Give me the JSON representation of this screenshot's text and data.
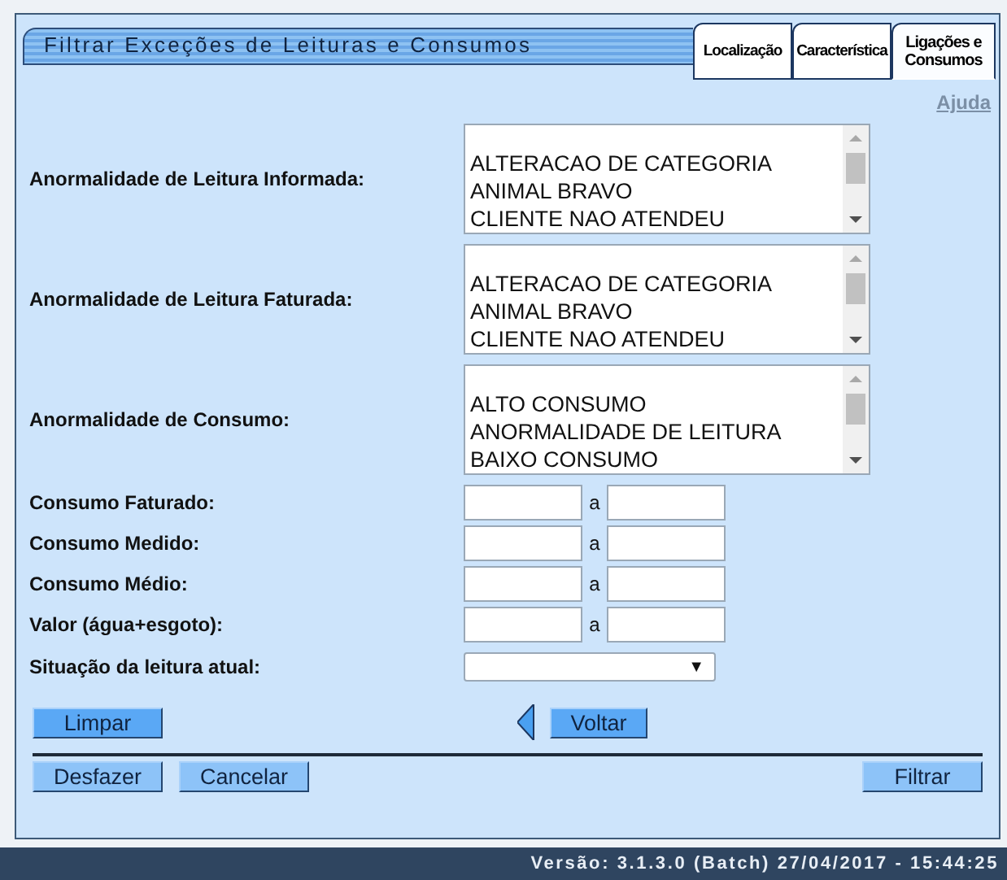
{
  "title": "Filtrar Exceções de Leituras e Consumos",
  "tabs": [
    {
      "label": "Localização",
      "selected": false
    },
    {
      "label": "Característica",
      "selected": false
    },
    {
      "label": "Ligações e Consumos",
      "selected": true
    }
  ],
  "help_link": "Ajuda",
  "list_fields": [
    {
      "label": "Anormalidade de Leitura Informada:",
      "options": [
        "ALTERACAO DE CATEGORIA",
        "ANIMAL BRAVO",
        "CLIENTE NAO ATENDEU"
      ]
    },
    {
      "label": "Anormalidade de Leitura Faturada:",
      "options": [
        "ALTERACAO DE CATEGORIA",
        "ANIMAL BRAVO",
        "CLIENTE NAO ATENDEU"
      ]
    },
    {
      "label": "Anormalidade de Consumo:",
      "options": [
        "ALTO CONSUMO",
        "ANORMALIDADE DE LEITURA",
        "BAIXO CONSUMO"
      ]
    }
  ],
  "range_fields": [
    {
      "label": "Consumo Faturado:",
      "separator": "a"
    },
    {
      "label": "Consumo Medido:",
      "separator": "a"
    },
    {
      "label": "Consumo Médio:",
      "separator": "a"
    },
    {
      "label": "Valor (água+esgoto):",
      "separator": "a"
    }
  ],
  "dropdown": {
    "label": "Situação da leitura atual:",
    "arrow": "▼"
  },
  "clear_button": "Limpar",
  "back_button": "Voltar",
  "footer_left_buttons": [
    "Desfazer",
    "Cancelar"
  ],
  "filter_button": "Filtrar",
  "status_bar": "Versão: 3.1.3.0 (Batch) 27/04/2017 - 15:44:25"
}
